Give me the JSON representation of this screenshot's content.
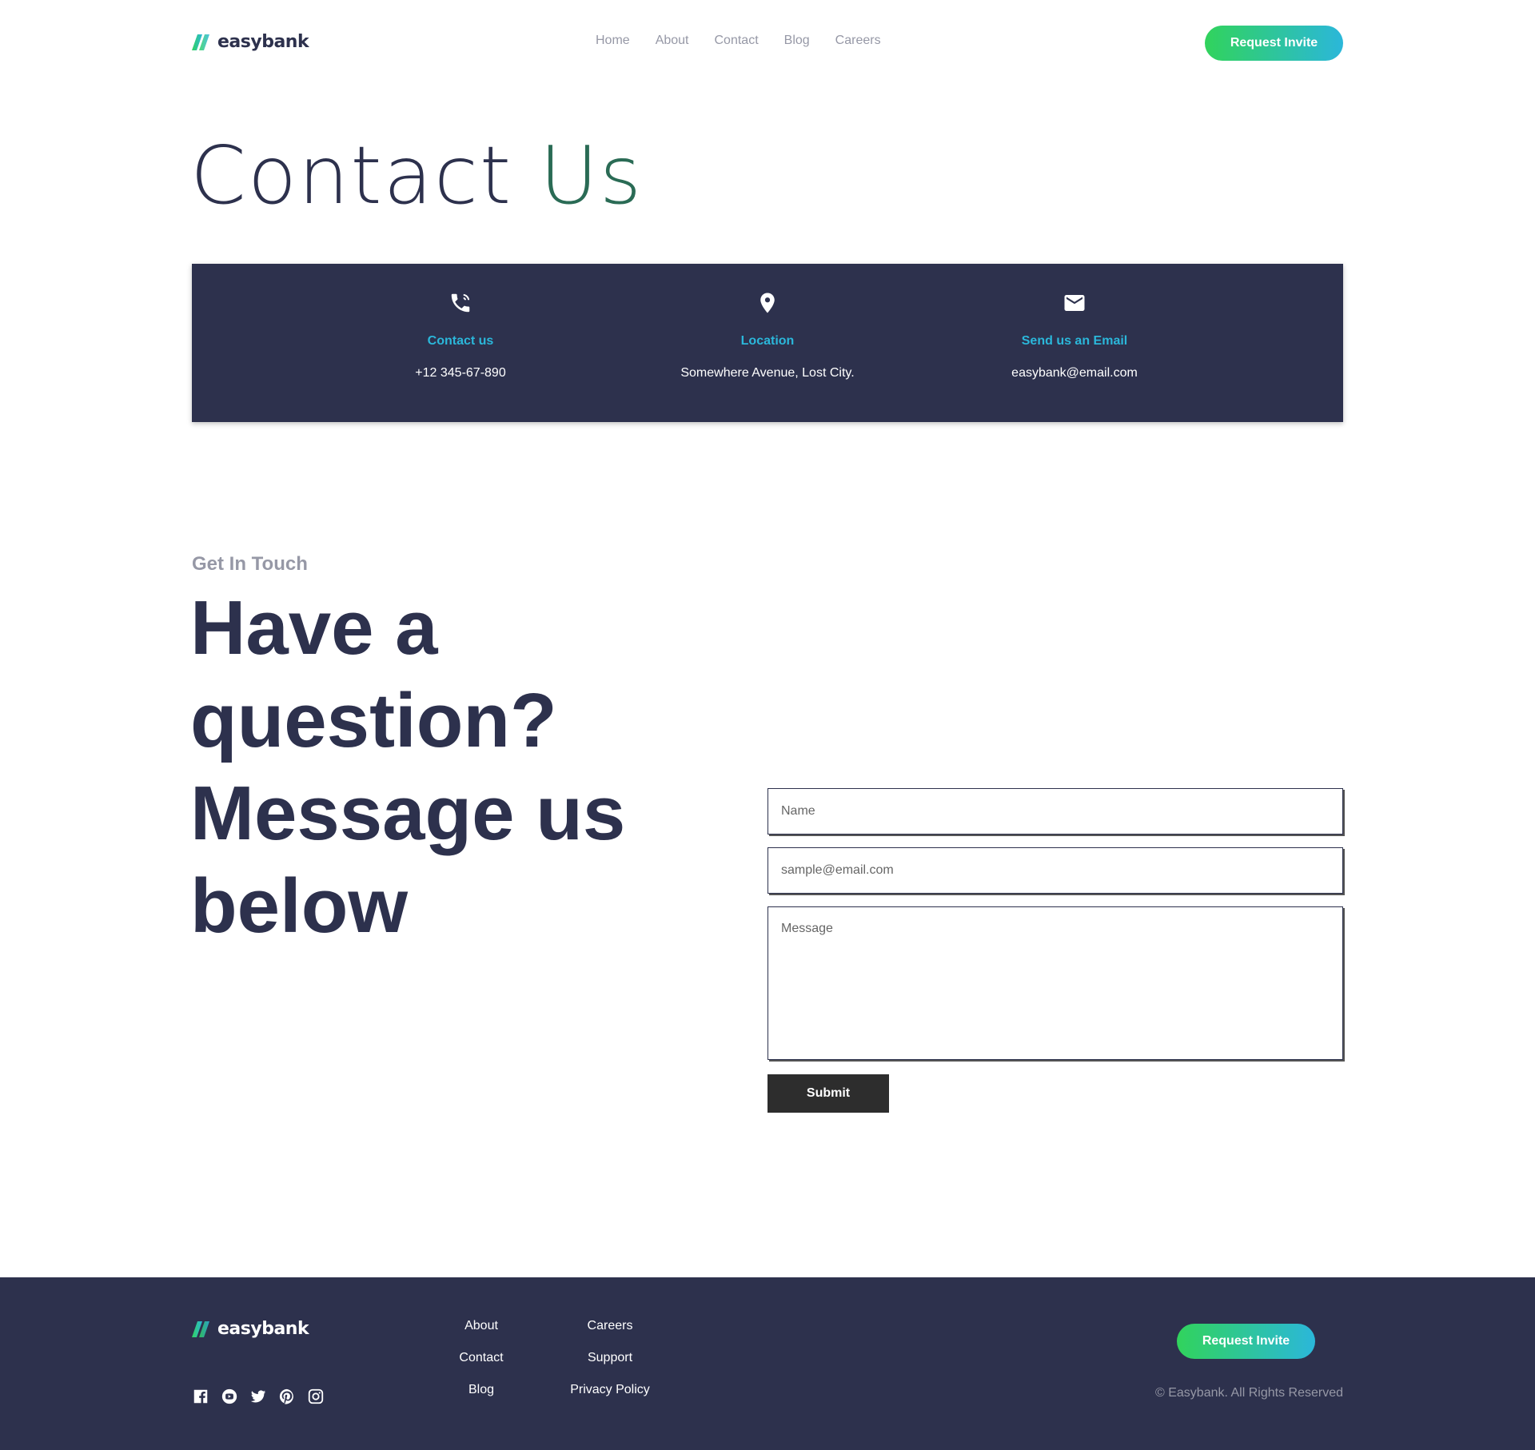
{
  "brand": {
    "name": "easybank",
    "accent_green": "#31d35c",
    "accent_cyan": "#2bb7da",
    "dark_blue": "#2d314d",
    "grayish_blue": "#9698a6"
  },
  "header": {
    "nav": [
      "Home",
      "About",
      "Contact",
      "Blog",
      "Careers"
    ],
    "cta": "Request Invite"
  },
  "title": {
    "part1": "Contact",
    "part2": "Us"
  },
  "info": [
    {
      "icon": "phone-icon",
      "label": "Contact us",
      "value": "+12 345-67-890"
    },
    {
      "icon": "location-pin-icon",
      "label": "Location",
      "value": "Somewhere Avenue, Lost City."
    },
    {
      "icon": "mail-icon",
      "label": "Send us an Email",
      "value": "easybank@email.com"
    }
  ],
  "touch": {
    "eyebrow": "Get In Touch",
    "headline": "Have a question? Message us below"
  },
  "form": {
    "name_placeholder": "Name",
    "email_placeholder": "sample@email.com",
    "message_placeholder": "Message",
    "submit": "Submit"
  },
  "footer": {
    "links_col1": [
      "About",
      "Contact",
      "Blog"
    ],
    "links_col2": [
      "Careers",
      "Support",
      "Privacy Policy"
    ],
    "socials": [
      "facebook-icon",
      "youtube-icon",
      "twitter-icon",
      "pinterest-icon",
      "instagram-icon"
    ],
    "cta": "Request Invite",
    "copyright": "© Easybank. All Rights Reserved"
  }
}
